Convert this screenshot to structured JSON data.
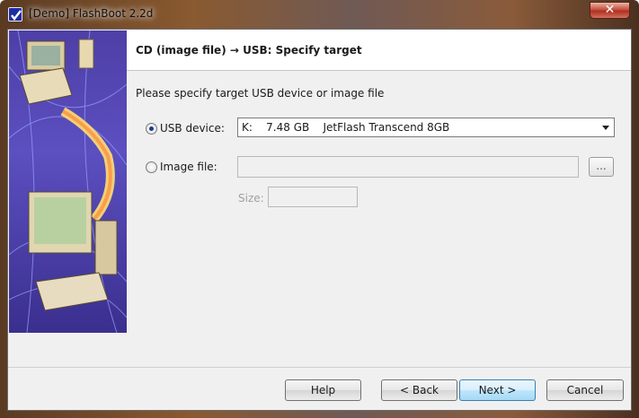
{
  "window": {
    "title": "[Demo] FlashBoot 2.2d",
    "close_glyph": "✕"
  },
  "header": {
    "title": "CD (image file) → USB: Specify target"
  },
  "instruction": "Please specify target USB device or image file",
  "usb_option": {
    "label": "USB device:",
    "selected": true,
    "value": "K:    7.48 GB    JetFlash Transcend 8GB"
  },
  "image_option": {
    "label": "Image file:",
    "selected": false,
    "value": "",
    "browse_label": "..."
  },
  "size": {
    "label": "Size:",
    "value": ""
  },
  "buttons": {
    "help": "Help",
    "back": "< Back",
    "next": "Next >",
    "cancel": "Cancel"
  },
  "icons": {
    "app": "flashboot-checkmark-icon",
    "close": "close-icon",
    "dropdown": "chevron-down-icon"
  },
  "colors": {
    "side_art": "#4d3fa6",
    "default_button_border": "#3c7fb1"
  }
}
